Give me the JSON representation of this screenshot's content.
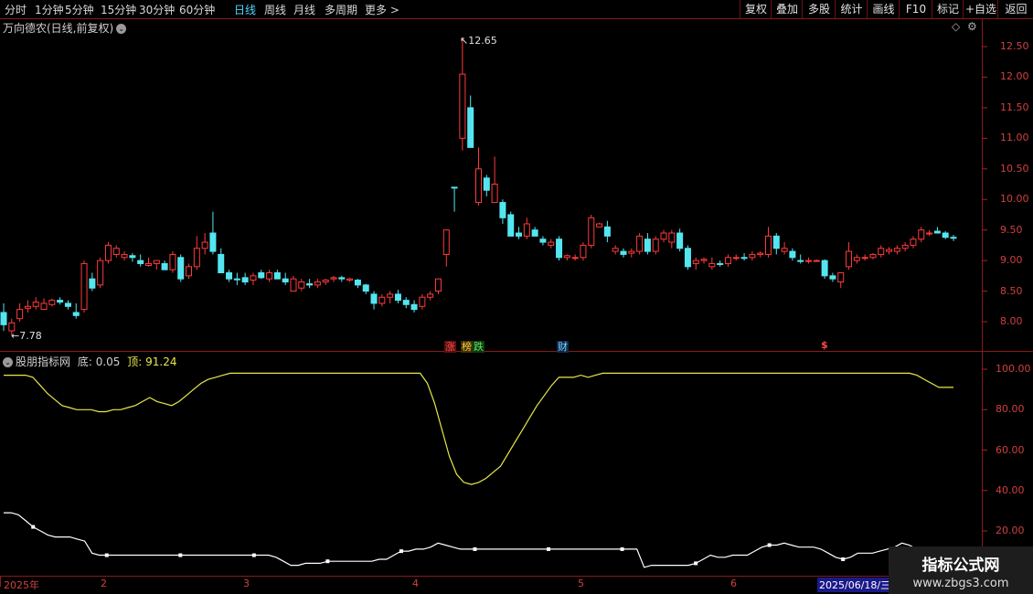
{
  "toolbar": {
    "periods": [
      "分时",
      "1分钟",
      "5分钟",
      "15分钟",
      "30分钟",
      "60分钟",
      "日线",
      "周线",
      "月线",
      "多周期",
      "更多 >"
    ],
    "active_period": "日线",
    "right_buttons": [
      "复权",
      "叠加",
      "多股",
      "统计",
      "画线",
      "F10",
      "标记",
      "+自选",
      "返回"
    ]
  },
  "main_panel": {
    "title": "万向德农(日线,前复权)",
    "high_label": "12.65",
    "low_label": "7.78",
    "y_ticks": [
      "12.50",
      "12.00",
      "11.50",
      "11.00",
      "10.50",
      "10.00",
      "9.50",
      "9.00",
      "8.50",
      "8.00"
    ],
    "markers": [
      {
        "text": "涨",
        "color": "#ff4a4a"
      },
      {
        "text": "榜",
        "color": "#ffd04a"
      },
      {
        "text": "跌",
        "color": "#5fe05f"
      },
      {
        "text": "财",
        "color": "#7fd0ff"
      },
      {
        "text": "$",
        "color": "#ff4a4a"
      }
    ]
  },
  "indicator_panel": {
    "title": "股朋指标网",
    "bottom_label": "底: 0.05",
    "top_label": "顶: 91.24",
    "y_ticks": [
      "100.00",
      "80.00",
      "60.00",
      "40.00",
      "20.00"
    ]
  },
  "x_axis": {
    "labels": [
      "2025年",
      "2",
      "3",
      "4",
      "5",
      "6"
    ],
    "cursor_date": "2025/06/18/三"
  },
  "watermark": {
    "line1": "指标公式网",
    "line2": "www.zbgs3.com"
  },
  "colors": {
    "up": "#ff3a3a",
    "down": "#54e6f0",
    "grid": "#8a1a1a",
    "top_line": "#e8e84a",
    "bottom_line": "#ffffff"
  },
  "chart_data": {
    "type": "candlestick",
    "ylim": [
      7.5,
      12.8
    ],
    "candles": [
      {
        "o": 7.95,
        "h": 8.3,
        "l": 7.85,
        "c": 8.15,
        "d": "down"
      },
      {
        "o": 7.85,
        "h": 8.05,
        "l": 7.78,
        "c": 7.98,
        "d": "up"
      },
      {
        "o": 8.05,
        "h": 8.3,
        "l": 8.0,
        "c": 8.2,
        "d": "up"
      },
      {
        "o": 8.22,
        "h": 8.35,
        "l": 8.15,
        "c": 8.25,
        "d": "up"
      },
      {
        "o": 8.25,
        "h": 8.4,
        "l": 8.2,
        "c": 8.32,
        "d": "up"
      },
      {
        "o": 8.3,
        "h": 8.38,
        "l": 8.2,
        "c": 8.2,
        "d": "up"
      },
      {
        "o": 8.28,
        "h": 8.38,
        "l": 8.25,
        "c": 8.35,
        "d": "up"
      },
      {
        "o": 8.35,
        "h": 8.4,
        "l": 8.28,
        "c": 8.32,
        "d": "down"
      },
      {
        "o": 8.3,
        "h": 8.35,
        "l": 8.2,
        "c": 8.25,
        "d": "down"
      },
      {
        "o": 8.15,
        "h": 8.3,
        "l": 8.05,
        "c": 8.1,
        "d": "down"
      },
      {
        "o": 8.2,
        "h": 9.0,
        "l": 8.15,
        "c": 8.95,
        "d": "up"
      },
      {
        "o": 8.7,
        "h": 8.8,
        "l": 8.5,
        "c": 8.55,
        "d": "down"
      },
      {
        "o": 8.6,
        "h": 9.05,
        "l": 8.55,
        "c": 9.0,
        "d": "up"
      },
      {
        "o": 9.0,
        "h": 9.3,
        "l": 8.95,
        "c": 9.25,
        "d": "up"
      },
      {
        "o": 9.2,
        "h": 9.25,
        "l": 9.05,
        "c": 9.1,
        "d": "up"
      },
      {
        "o": 9.1,
        "h": 9.15,
        "l": 9.0,
        "c": 9.05,
        "d": "up"
      },
      {
        "o": 9.05,
        "h": 9.12,
        "l": 8.98,
        "c": 9.08,
        "d": "down"
      },
      {
        "o": 9.0,
        "h": 9.1,
        "l": 8.9,
        "c": 8.95,
        "d": "down"
      },
      {
        "o": 8.95,
        "h": 9.05,
        "l": 8.9,
        "c": 8.92,
        "d": "up"
      },
      {
        "o": 8.95,
        "h": 9.0,
        "l": 8.85,
        "c": 9.0,
        "d": "up"
      },
      {
        "o": 8.95,
        "h": 9.0,
        "l": 8.85,
        "c": 8.85,
        "d": "down"
      },
      {
        "o": 8.85,
        "h": 9.15,
        "l": 8.8,
        "c": 9.1,
        "d": "up"
      },
      {
        "o": 9.05,
        "h": 9.1,
        "l": 8.65,
        "c": 8.7,
        "d": "down"
      },
      {
        "o": 8.75,
        "h": 8.95,
        "l": 8.7,
        "c": 8.9,
        "d": "up"
      },
      {
        "o": 8.9,
        "h": 9.4,
        "l": 8.85,
        "c": 9.2,
        "d": "up"
      },
      {
        "o": 9.2,
        "h": 9.45,
        "l": 9.1,
        "c": 9.3,
        "d": "up"
      },
      {
        "o": 9.45,
        "h": 9.8,
        "l": 9.1,
        "c": 9.15,
        "d": "down"
      },
      {
        "o": 9.1,
        "h": 9.2,
        "l": 8.8,
        "c": 8.8,
        "d": "down"
      },
      {
        "o": 8.8,
        "h": 8.85,
        "l": 8.65,
        "c": 8.7,
        "d": "down"
      },
      {
        "o": 8.7,
        "h": 8.8,
        "l": 8.6,
        "c": 8.7,
        "d": "down"
      },
      {
        "o": 8.72,
        "h": 8.8,
        "l": 8.6,
        "c": 8.65,
        "d": "down"
      },
      {
        "o": 8.68,
        "h": 8.8,
        "l": 8.6,
        "c": 8.75,
        "d": "up"
      },
      {
        "o": 8.8,
        "h": 8.85,
        "l": 8.7,
        "c": 8.72,
        "d": "down"
      },
      {
        "o": 8.7,
        "h": 8.85,
        "l": 8.65,
        "c": 8.8,
        "d": "up"
      },
      {
        "o": 8.8,
        "h": 8.85,
        "l": 8.7,
        "c": 8.7,
        "d": "down"
      },
      {
        "o": 8.7,
        "h": 8.8,
        "l": 8.6,
        "c": 8.65,
        "d": "down"
      },
      {
        "o": 8.7,
        "h": 8.75,
        "l": 8.5,
        "c": 8.5,
        "d": "up"
      },
      {
        "o": 8.55,
        "h": 8.7,
        "l": 8.5,
        "c": 8.65,
        "d": "up"
      },
      {
        "o": 8.62,
        "h": 8.7,
        "l": 8.55,
        "c": 8.6,
        "d": "down"
      },
      {
        "o": 8.6,
        "h": 8.7,
        "l": 8.55,
        "c": 8.65,
        "d": "up"
      },
      {
        "o": 8.68,
        "h": 8.7,
        "l": 8.6,
        "c": 8.65,
        "d": "up"
      },
      {
        "o": 8.7,
        "h": 8.75,
        "l": 8.65,
        "c": 8.72,
        "d": "up"
      },
      {
        "o": 8.72,
        "h": 8.75,
        "l": 8.65,
        "c": 8.7,
        "d": "down"
      },
      {
        "o": 8.7,
        "h": 8.72,
        "l": 8.65,
        "c": 8.68,
        "d": "up"
      },
      {
        "o": 8.68,
        "h": 8.7,
        "l": 8.55,
        "c": 8.6,
        "d": "down"
      },
      {
        "o": 8.6,
        "h": 8.62,
        "l": 8.45,
        "c": 8.5,
        "d": "down"
      },
      {
        "o": 8.45,
        "h": 8.5,
        "l": 8.2,
        "c": 8.3,
        "d": "down"
      },
      {
        "o": 8.3,
        "h": 8.45,
        "l": 8.25,
        "c": 8.4,
        "d": "up"
      },
      {
        "o": 8.4,
        "h": 8.5,
        "l": 8.3,
        "c": 8.45,
        "d": "up"
      },
      {
        "o": 8.45,
        "h": 8.52,
        "l": 8.3,
        "c": 8.35,
        "d": "down"
      },
      {
        "o": 8.35,
        "h": 8.4,
        "l": 8.22,
        "c": 8.28,
        "d": "down"
      },
      {
        "o": 8.28,
        "h": 8.35,
        "l": 8.15,
        "c": 8.2,
        "d": "down"
      },
      {
        "o": 8.25,
        "h": 8.45,
        "l": 8.2,
        "c": 8.4,
        "d": "up"
      },
      {
        "o": 8.4,
        "h": 8.5,
        "l": 8.35,
        "c": 8.45,
        "d": "up"
      },
      {
        "o": 8.5,
        "h": 8.7,
        "l": 8.45,
        "c": 8.7,
        "d": "up"
      },
      {
        "o": 9.1,
        "h": 9.5,
        "l": 8.9,
        "c": 9.5,
        "d": "up"
      },
      {
        "o": 10.2,
        "h": 10.2,
        "l": 9.8,
        "c": 10.2,
        "d": "down"
      },
      {
        "o": 11.0,
        "h": 12.65,
        "l": 10.8,
        "c": 12.05,
        "d": "up"
      },
      {
        "o": 11.5,
        "h": 11.7,
        "l": 10.9,
        "c": 10.85,
        "d": "down"
      },
      {
        "o": 10.5,
        "h": 10.85,
        "l": 9.9,
        "c": 9.95,
        "d": "up"
      },
      {
        "o": 10.35,
        "h": 10.4,
        "l": 10.05,
        "c": 10.15,
        "d": "down"
      },
      {
        "o": 10.25,
        "h": 10.7,
        "l": 9.95,
        "c": 9.95,
        "d": "up"
      },
      {
        "o": 9.95,
        "h": 10.0,
        "l": 9.6,
        "c": 9.7,
        "d": "down"
      },
      {
        "o": 9.75,
        "h": 9.8,
        "l": 9.4,
        "c": 9.4,
        "d": "down"
      },
      {
        "o": 9.45,
        "h": 9.55,
        "l": 9.35,
        "c": 9.4,
        "d": "down"
      },
      {
        "o": 9.4,
        "h": 9.7,
        "l": 9.35,
        "c": 9.6,
        "d": "up"
      },
      {
        "o": 9.5,
        "h": 9.55,
        "l": 9.4,
        "c": 9.4,
        "d": "down"
      },
      {
        "o": 9.35,
        "h": 9.4,
        "l": 9.25,
        "c": 9.3,
        "d": "down"
      },
      {
        "o": 9.25,
        "h": 9.35,
        "l": 9.2,
        "c": 9.3,
        "d": "up"
      },
      {
        "o": 9.35,
        "h": 9.4,
        "l": 9.0,
        "c": 9.05,
        "d": "down"
      },
      {
        "o": 9.05,
        "h": 9.1,
        "l": 9.0,
        "c": 9.08,
        "d": "up"
      },
      {
        "o": 9.05,
        "h": 9.1,
        "l": 9.0,
        "c": 9.05,
        "d": "up"
      },
      {
        "o": 9.05,
        "h": 9.3,
        "l": 9.0,
        "c": 9.25,
        "d": "up"
      },
      {
        "o": 9.25,
        "h": 9.75,
        "l": 9.2,
        "c": 9.7,
        "d": "up"
      },
      {
        "o": 9.6,
        "h": 9.62,
        "l": 9.55,
        "c": 9.55,
        "d": "up"
      },
      {
        "o": 9.55,
        "h": 9.65,
        "l": 9.3,
        "c": 9.4,
        "d": "down"
      },
      {
        "o": 9.2,
        "h": 9.25,
        "l": 9.1,
        "c": 9.15,
        "d": "up"
      },
      {
        "o": 9.15,
        "h": 9.2,
        "l": 9.05,
        "c": 9.1,
        "d": "down"
      },
      {
        "o": 9.12,
        "h": 9.2,
        "l": 9.05,
        "c": 9.15,
        "d": "up"
      },
      {
        "o": 9.15,
        "h": 9.45,
        "l": 9.1,
        "c": 9.4,
        "d": "up"
      },
      {
        "o": 9.35,
        "h": 9.45,
        "l": 9.1,
        "c": 9.15,
        "d": "down"
      },
      {
        "o": 9.15,
        "h": 9.4,
        "l": 9.1,
        "c": 9.35,
        "d": "up"
      },
      {
        "o": 9.35,
        "h": 9.5,
        "l": 9.3,
        "c": 9.45,
        "d": "up"
      },
      {
        "o": 9.45,
        "h": 9.5,
        "l": 9.2,
        "c": 9.3,
        "d": "up"
      },
      {
        "o": 9.45,
        "h": 9.52,
        "l": 9.15,
        "c": 9.2,
        "d": "down"
      },
      {
        "o": 9.2,
        "h": 9.25,
        "l": 8.85,
        "c": 8.9,
        "d": "down"
      },
      {
        "o": 8.95,
        "h": 9.05,
        "l": 8.85,
        "c": 9.0,
        "d": "up"
      },
      {
        "o": 9.0,
        "h": 9.05,
        "l": 8.95,
        "c": 9.02,
        "d": "up"
      },
      {
        "o": 8.95,
        "h": 9.05,
        "l": 8.85,
        "c": 8.9,
        "d": "up"
      },
      {
        "o": 8.95,
        "h": 9.0,
        "l": 8.9,
        "c": 8.95,
        "d": "down"
      },
      {
        "o": 8.95,
        "h": 9.1,
        "l": 8.9,
        "c": 9.05,
        "d": "up"
      },
      {
        "o": 9.05,
        "h": 9.1,
        "l": 9.0,
        "c": 9.05,
        "d": "up"
      },
      {
        "o": 9.05,
        "h": 9.12,
        "l": 9.0,
        "c": 9.05,
        "d": "down"
      },
      {
        "o": 9.05,
        "h": 9.15,
        "l": 9.0,
        "c": 9.1,
        "d": "up"
      },
      {
        "o": 9.1,
        "h": 9.15,
        "l": 9.05,
        "c": 9.12,
        "d": "up"
      },
      {
        "o": 9.1,
        "h": 9.55,
        "l": 9.05,
        "c": 9.4,
        "d": "up"
      },
      {
        "o": 9.4,
        "h": 9.45,
        "l": 9.1,
        "c": 9.2,
        "d": "down"
      },
      {
        "o": 9.2,
        "h": 9.3,
        "l": 9.1,
        "c": 9.15,
        "d": "up"
      },
      {
        "o": 9.15,
        "h": 9.2,
        "l": 9.0,
        "c": 9.05,
        "d": "down"
      },
      {
        "o": 9.0,
        "h": 9.1,
        "l": 8.95,
        "c": 9.0,
        "d": "down"
      },
      {
        "o": 9.0,
        "h": 9.05,
        "l": 8.95,
        "c": 9.0,
        "d": "up"
      },
      {
        "o": 9.0,
        "h": 9.02,
        "l": 8.98,
        "c": 9.0,
        "d": "up"
      },
      {
        "o": 9.0,
        "h": 9.02,
        "l": 8.7,
        "c": 8.75,
        "d": "down"
      },
      {
        "o": 8.75,
        "h": 8.8,
        "l": 8.65,
        "c": 8.7,
        "d": "down"
      },
      {
        "o": 8.65,
        "h": 8.8,
        "l": 8.55,
        "c": 8.8,
        "d": "up"
      },
      {
        "o": 8.9,
        "h": 9.3,
        "l": 8.85,
        "c": 9.15,
        "d": "up"
      },
      {
        "o": 9.0,
        "h": 9.1,
        "l": 8.95,
        "c": 9.05,
        "d": "up"
      },
      {
        "o": 9.05,
        "h": 9.1,
        "l": 9.0,
        "c": 9.05,
        "d": "up"
      },
      {
        "o": 9.05,
        "h": 9.12,
        "l": 9.02,
        "c": 9.1,
        "d": "up"
      },
      {
        "o": 9.1,
        "h": 9.25,
        "l": 9.05,
        "c": 9.2,
        "d": "up"
      },
      {
        "o": 9.18,
        "h": 9.22,
        "l": 9.1,
        "c": 9.15,
        "d": "up"
      },
      {
        "o": 9.15,
        "h": 9.25,
        "l": 9.1,
        "c": 9.2,
        "d": "up"
      },
      {
        "o": 9.2,
        "h": 9.3,
        "l": 9.15,
        "c": 9.25,
        "d": "up"
      },
      {
        "o": 9.25,
        "h": 9.4,
        "l": 9.2,
        "c": 9.35,
        "d": "up"
      },
      {
        "o": 9.35,
        "h": 9.55,
        "l": 9.3,
        "c": 9.5,
        "d": "up"
      },
      {
        "o": 9.45,
        "h": 9.5,
        "l": 9.4,
        "c": 9.45,
        "d": "up"
      },
      {
        "o": 9.48,
        "h": 9.55,
        "l": 9.45,
        "c": 9.45,
        "d": "down"
      },
      {
        "o": 9.45,
        "h": 9.48,
        "l": 9.35,
        "c": 9.38,
        "d": "down"
      },
      {
        "o": 9.38,
        "h": 9.42,
        "l": 9.32,
        "c": 9.38,
        "d": "down"
      }
    ],
    "indicator_top": [
      97,
      97,
      97,
      97,
      96,
      92,
      88,
      85,
      82,
      81,
      80,
      80,
      80,
      79,
      79,
      80,
      80,
      81,
      82,
      84,
      86,
      84,
      83,
      82,
      84,
      87,
      90,
      93,
      95,
      96,
      97,
      98,
      98,
      98,
      98,
      98,
      98,
      98,
      98,
      98,
      98,
      98,
      98,
      98,
      98,
      98,
      98,
      98,
      98,
      98,
      98,
      98,
      98,
      98,
      98,
      98,
      98,
      98,
      93,
      83,
      70,
      57,
      48,
      44,
      43,
      44,
      46,
      49,
      52,
      58,
      64,
      70,
      76,
      82,
      87,
      92,
      96,
      96,
      96,
      97,
      96,
      97,
      98,
      98,
      98,
      98,
      98,
      98,
      98,
      98,
      98,
      98,
      98,
      98,
      98,
      98,
      98,
      98,
      98,
      98,
      98,
      98,
      98,
      98,
      98,
      98,
      98,
      98,
      98,
      98,
      98,
      98,
      98,
      98,
      98,
      98,
      98,
      98,
      98,
      98,
      98,
      98,
      98,
      98,
      98,
      97,
      95,
      93,
      91,
      91,
      91
    ],
    "indicator_bottom": [
      29,
      29,
      28,
      25,
      22,
      20,
      18,
      17,
      17,
      17,
      16,
      15,
      9,
      8,
      8,
      8,
      8,
      8,
      8,
      8,
      8,
      8,
      8,
      8,
      8,
      8,
      8,
      8,
      8,
      8,
      8,
      8,
      8,
      8,
      8,
      8,
      8,
      7,
      5,
      3,
      3,
      4,
      4,
      4,
      5,
      5,
      5,
      5,
      5,
      5,
      5,
      6,
      6,
      8,
      10,
      10,
      11,
      11,
      12,
      14,
      13,
      12,
      11,
      11,
      11,
      11,
      11,
      11,
      11,
      11,
      11,
      11,
      11,
      11,
      11,
      11,
      11,
      11,
      11,
      11,
      11,
      11,
      11,
      11,
      11,
      11,
      11,
      2,
      3,
      3,
      3,
      3,
      3,
      3,
      4,
      6,
      8,
      7,
      7,
      8,
      8,
      8,
      10,
      12,
      13,
      13,
      14,
      13,
      12,
      12,
      12,
      11,
      9,
      7,
      6,
      7,
      9,
      9,
      9,
      10,
      11,
      12,
      14,
      13,
      11,
      10,
      9,
      9,
      8,
      8
    ]
  }
}
